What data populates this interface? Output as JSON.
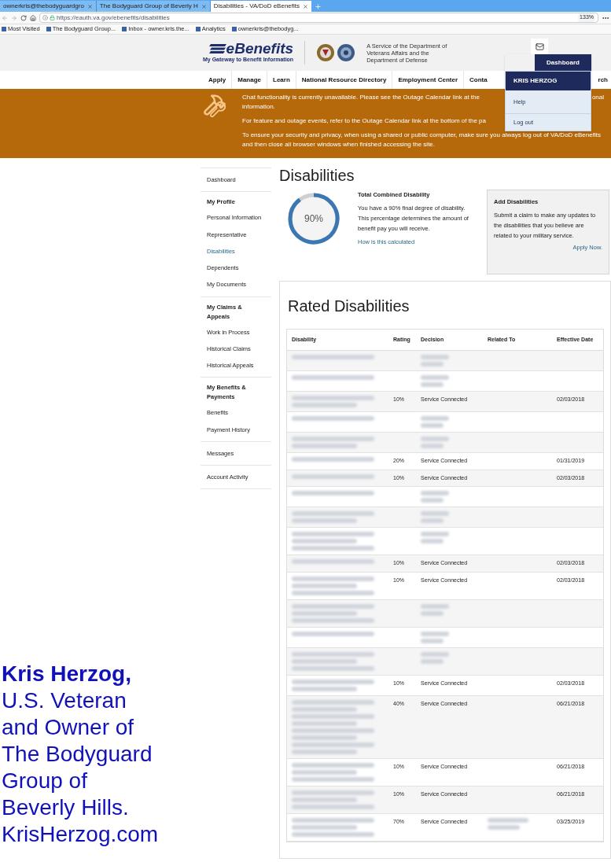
{
  "browser": {
    "tabs": [
      {
        "label": "ownerkris@thebodyguardgro",
        "selected": false
      },
      {
        "label": "The Bodyguard Group of Beverly H",
        "selected": false
      },
      {
        "label": "Disabilities - VA/DoD eBenefits",
        "selected": true
      }
    ],
    "url": "https://eauth.va.gov/ebenefits/disabilities",
    "zoom": "133%",
    "bookmarks": [
      "Most Visited",
      "The Bodyguard Group...",
      "Inbox - owner.kris.the...",
      "Analytics",
      "ownerkris@thebodyg..."
    ]
  },
  "header": {
    "logo": "eBenefits",
    "tagline": "My Gateway to Benefit Information",
    "service": "A Service of the Department of\nVeterans Affairs and the\nDepartment of Defense"
  },
  "nav": [
    "Apply",
    "Manage",
    "Learn",
    "National Resource Directory",
    "Employment Center",
    "Conta",
    "rch"
  ],
  "user_menu": {
    "button": "Dashboard",
    "name": "KRIS HERZOG",
    "items": [
      "Help",
      "Log out"
    ]
  },
  "banner": {
    "line_1a": "Chat functionality is currently unavailable. Please see the Outage Calendar link at the",
    "line_1b": "onal",
    "line_1c": "information.",
    "line_2": "For feature and outage events, refer to the Outage Calendar link at the bottom of the pa",
    "line_3": "To ensure your security and privacy, when using a shared or public computer, make sure you always log out of VA/DoD eBenefits and then close all browser windows when finished accessing the site."
  },
  "sidebar": [
    {
      "items": [
        {
          "label": "Dashboard",
          "selected": false
        }
      ]
    },
    {
      "heading": "My Profile",
      "items": [
        {
          "label": "Personal Information",
          "selected": false
        },
        {
          "label": "Representative",
          "selected": false
        },
        {
          "label": "Disabilities",
          "selected": true
        },
        {
          "label": "Dependents",
          "selected": false
        },
        {
          "label": "My Documents",
          "selected": false
        }
      ]
    },
    {
      "heading": "My Claims & Appeals",
      "items": [
        {
          "label": "Work in Process",
          "selected": false
        },
        {
          "label": "Historical Claims",
          "selected": false
        },
        {
          "label": "Historical Appeals",
          "selected": false
        }
      ]
    },
    {
      "heading": "My Benefits & Payments",
      "items": [
        {
          "label": "Benefits",
          "selected": false
        },
        {
          "label": "Payment History",
          "selected": false
        }
      ]
    },
    {
      "items": [
        {
          "label": "Messages",
          "selected": false
        }
      ]
    },
    {
      "items": [
        {
          "label": "Account Activity",
          "selected": false
        }
      ]
    }
  ],
  "page_title": "Disabilities",
  "combined": {
    "level": 0.9,
    "value": "90%",
    "title": "Total Combined Disability",
    "text": "You have a 90% final degree of disability. This percentage determines the amount of benefit pay you will receive.",
    "link": "How is this calculated"
  },
  "add_card": {
    "title": "Add Disabilities",
    "text": "Submit a claim to make any updates to the disabilities that you believe are related to your military service.",
    "link": "Apply Now."
  },
  "rated": {
    "title": "Rated Disabilities",
    "columns": [
      "Disability",
      "Rating",
      "Decision",
      "Related To",
      "Effective Date"
    ],
    "rows": [
      {
        "kind": "single"
      },
      {
        "kind": "single"
      },
      {
        "kind": "double",
        "rating": "10%",
        "decision": "Service Connected",
        "date": "02/03/2018"
      },
      {
        "kind": "single"
      },
      {
        "kind": "double"
      },
      {
        "kind": "single",
        "rating": "20%",
        "decision": "Service Connected",
        "date": "01/31/2019"
      },
      {
        "kind": "single",
        "rating": "10%",
        "decision": "Service Connected",
        "date": "02/03/2018"
      },
      {
        "kind": "single"
      },
      {
        "kind": "double"
      },
      {
        "kind": "triple"
      },
      {
        "kind": "single",
        "rating": "10%",
        "decision": "Service Connected",
        "date": "02/03/2018"
      },
      {
        "kind": "triple",
        "rating": "10%",
        "decision": "Service Connected",
        "date": "02/03/2018"
      },
      {
        "kind": "triple"
      },
      {
        "kind": "single"
      },
      {
        "kind": "triple"
      },
      {
        "kind": "double",
        "rating": "10%",
        "decision": "Service Connected",
        "date": "02/03/2018"
      },
      {
        "kind": "long",
        "rating": "40%",
        "decision": "Service Connected",
        "date": "06/21/2018"
      },
      {
        "kind": "triple",
        "rating": "10%",
        "decision": "Service Connected",
        "date": "06/21/2018"
      },
      {
        "kind": "triple",
        "rating": "10%",
        "decision": "Service Connected",
        "date": "06/21/2018"
      },
      {
        "kind": "triple",
        "rating": "70%",
        "decision": "Service Connected",
        "related_blurred": true,
        "date": "03/25/2019"
      }
    ]
  },
  "caption": "**Kris Herzog,**\nU.S. Veteran\nand Owner of\nThe Bodyguard\nGroup of\nBeverly Hills.\nKrisHerzog.com"
}
